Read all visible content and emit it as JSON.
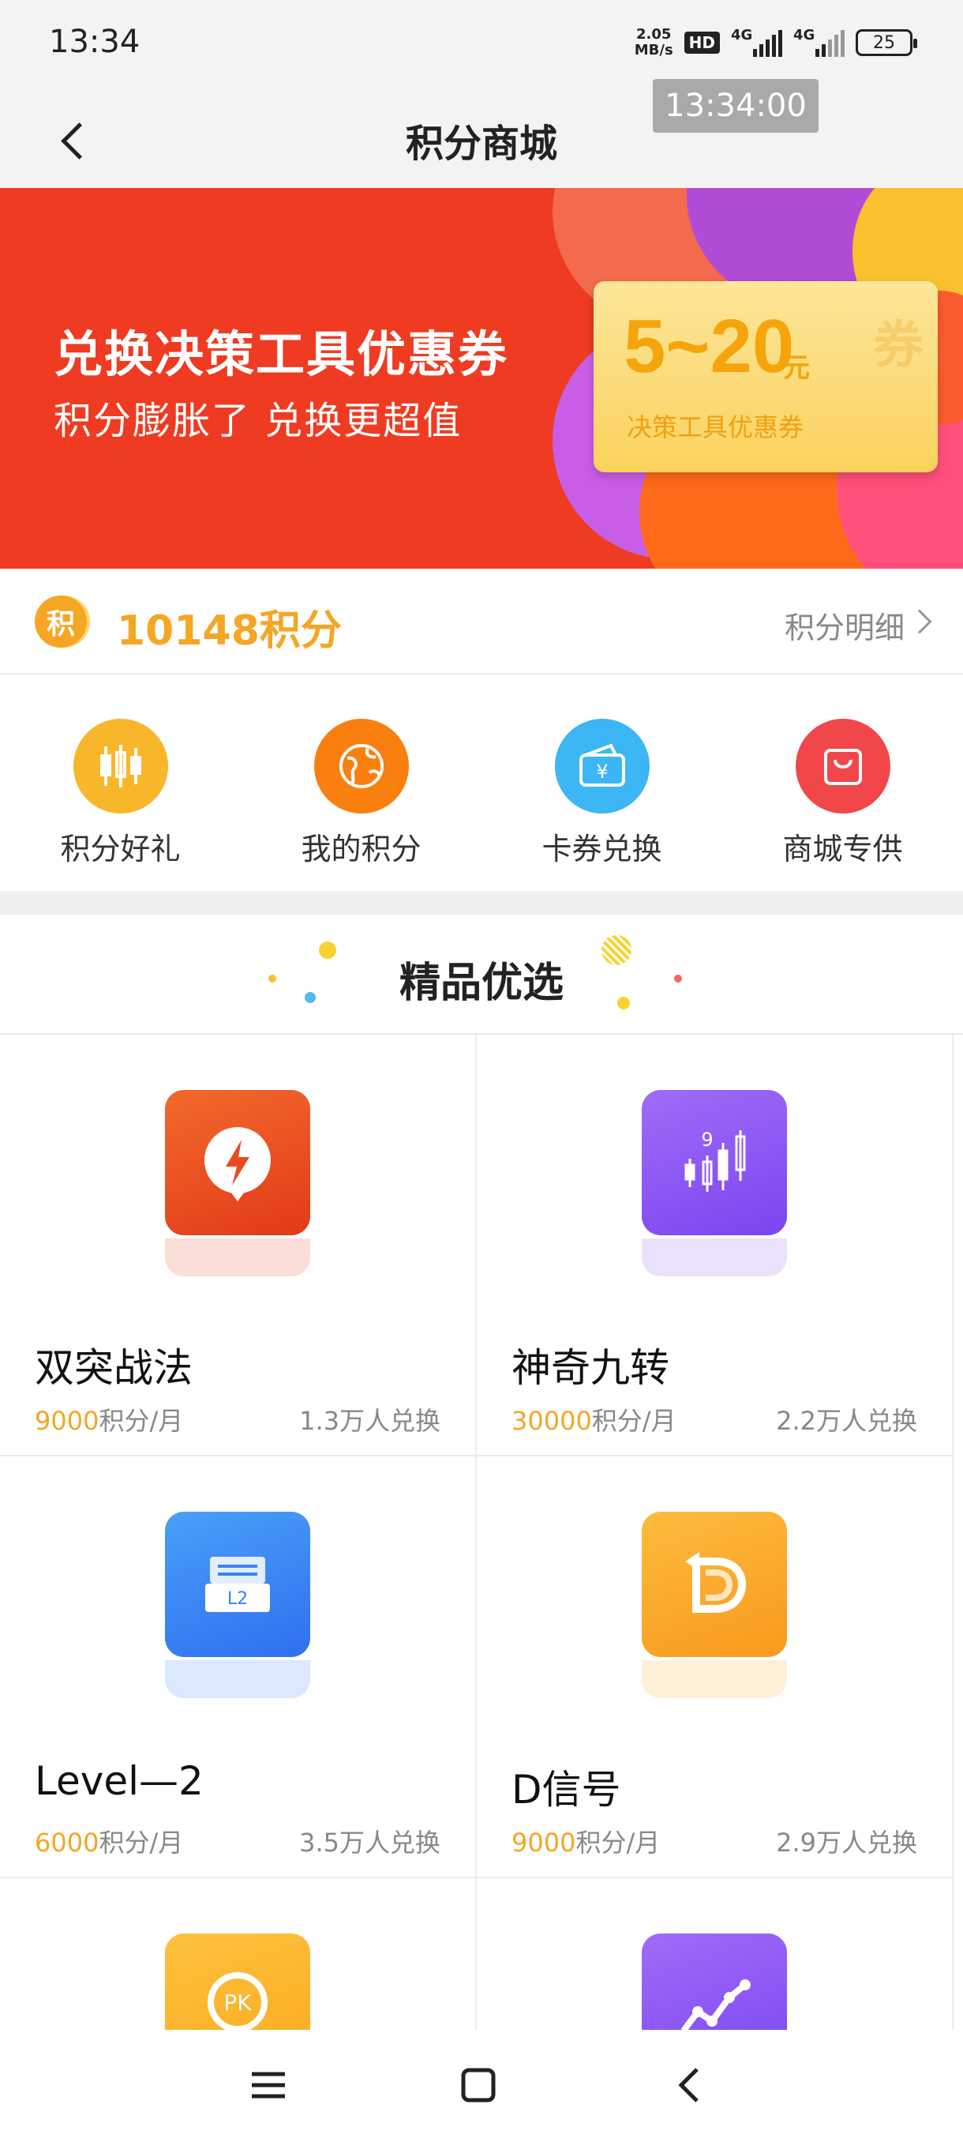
{
  "status_bar": {
    "time": "13:34",
    "speed_top": "2.05",
    "speed_unit": "MB/s",
    "hd_label": "HD",
    "network_1": "4G",
    "network_2": "4G",
    "battery": "25"
  },
  "header": {
    "title": "积分商城",
    "overlay_time": "13:34:00"
  },
  "banner": {
    "title": "兑换决策工具优惠券",
    "subtitle": "积分膨胀了 兑换更超值",
    "coupon_amount": "5~20",
    "coupon_unit": "元",
    "coupon_desc": "决策工具优惠券",
    "coupon_stub": "券",
    "colors": {
      "background": "#ef3b22",
      "coupon": "#fbd25d",
      "coupon_text": "#f5a50b"
    }
  },
  "points": {
    "icon_char": "积",
    "value": "10148积分",
    "detail_link": "积分明细"
  },
  "quick_actions": [
    {
      "label": "积分好礼",
      "icon": "candlestick-icon",
      "color": "#f8b62b"
    },
    {
      "label": "我的积分",
      "icon": "globe-icon",
      "color": "#f97f0f"
    },
    {
      "label": "卡券兑换",
      "icon": "wallet-icon",
      "color": "#3cb6f5"
    },
    {
      "label": "商城专供",
      "icon": "shopping-bag-icon",
      "color": "#f2474a"
    }
  ],
  "section": {
    "title": "精品优选"
  },
  "products": [
    {
      "name": "双突战法",
      "points": "9000",
      "unit": "积分/月",
      "count": "1.3万人兑换",
      "icon": "lightning-icon",
      "color": "#ea4a1f"
    },
    {
      "name": "神奇九转",
      "points": "30000",
      "unit": "积分/月",
      "count": "2.2万人兑换",
      "icon": "nine-turn-chart-icon",
      "color": "#8a5cf6"
    },
    {
      "name": "Level—2",
      "points": "6000",
      "unit": "积分/月",
      "count": "3.5万人兑换",
      "icon": "level2-icon",
      "color": "#3b82f0"
    },
    {
      "name": "D信号",
      "points": "9000",
      "unit": "积分/月",
      "count": "2.9万人兑换",
      "icon": "d-signal-icon",
      "color": "#fbaa2a"
    },
    {
      "name": "",
      "points": "",
      "unit": "",
      "count": "",
      "icon": "pk-icon",
      "color": "#fbb72e"
    },
    {
      "name": "",
      "points": "",
      "unit": "",
      "count": "",
      "icon": "trend-chart-icon",
      "color": "#8a5cf6"
    }
  ],
  "pk_label": "PK",
  "level2_label": "L2",
  "nine_label": "9"
}
